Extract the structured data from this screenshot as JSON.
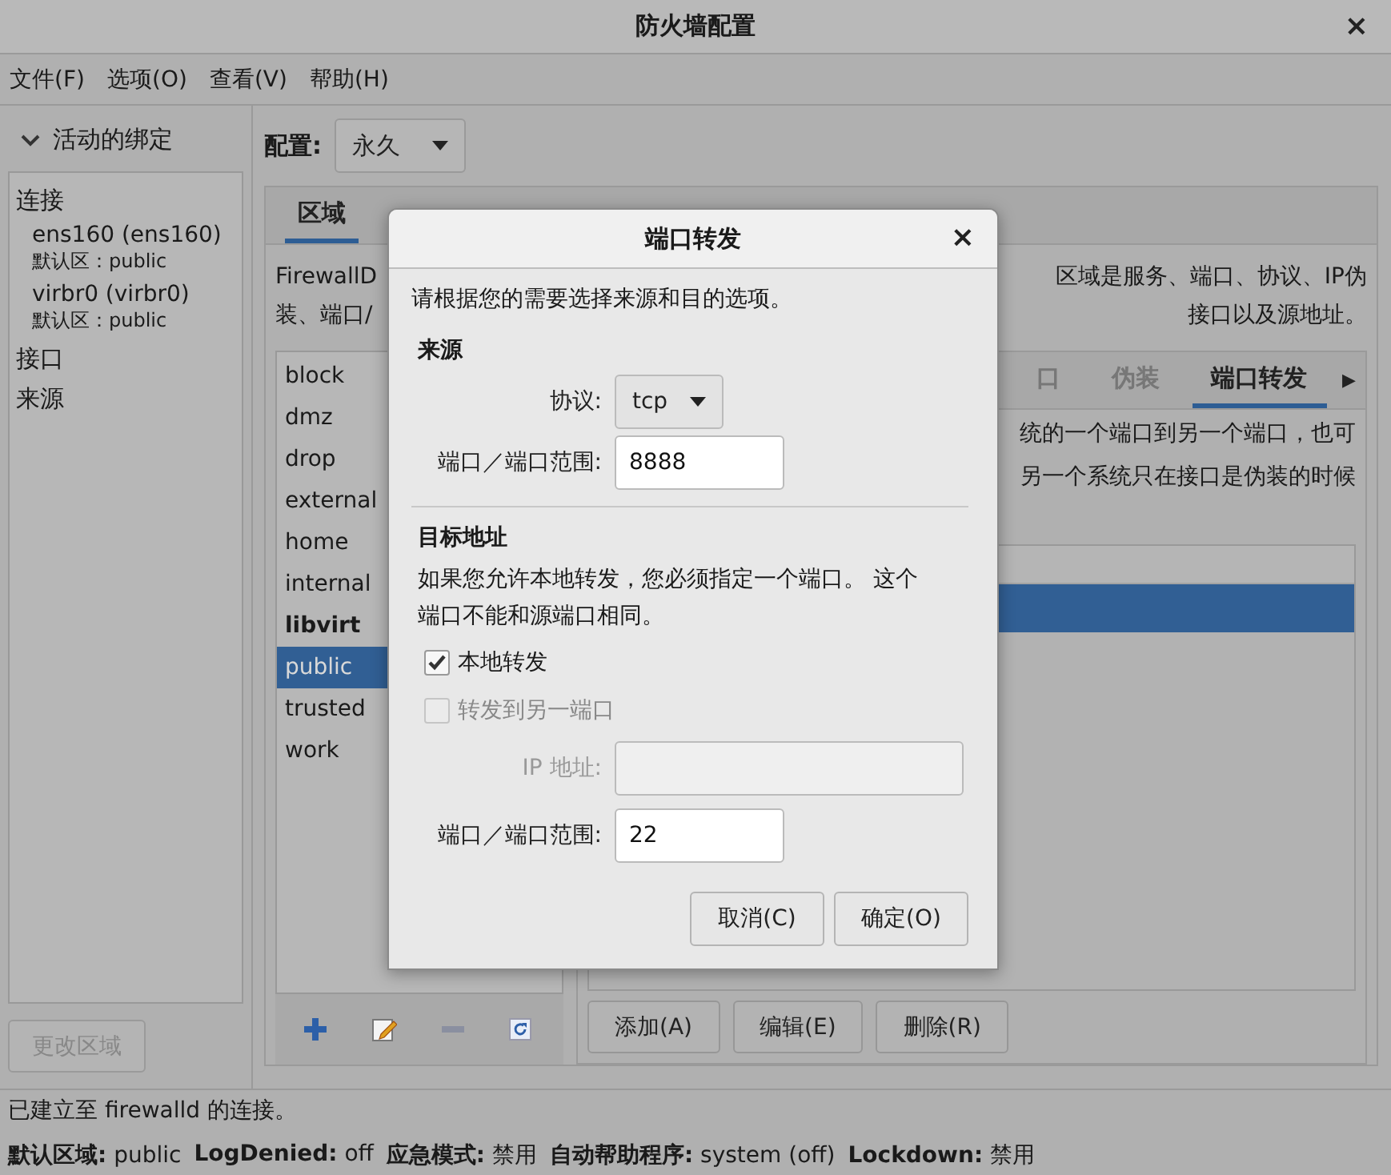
{
  "window": {
    "title": "防火墙配置",
    "close": "×"
  },
  "menu": [
    {
      "label": "文件(F)"
    },
    {
      "label": "选项(O)"
    },
    {
      "label": "查看(V)"
    },
    {
      "label": "帮助(H)"
    }
  ],
  "sidebar": {
    "header": "活动的绑定",
    "expanded": true,
    "tree": [
      {
        "label": "连接",
        "children": [
          {
            "label": "ens160 (ens160)",
            "zone": "默认区：public"
          },
          {
            "label": "virbr0 (virbr0)",
            "zone": "默认区：public"
          }
        ]
      },
      {
        "label": "接口"
      },
      {
        "label": "来源"
      }
    ],
    "button": {
      "label": "更改区域",
      "disabled": true
    }
  },
  "config": {
    "label": "配置:",
    "value": "永久"
  },
  "tabs": [
    {
      "label": "区域",
      "selected": true
    }
  ],
  "description": {
    "left": [
      "FirewallD",
      "装、端口/"
    ],
    "right": [
      "区域是服务、端口、协议、IP伪",
      "接口以及源地址。"
    ]
  },
  "zones": [
    {
      "name": "block",
      "emphasized": false,
      "selected": false
    },
    {
      "name": "dmz",
      "emphasized": false,
      "selected": false
    },
    {
      "name": "drop",
      "emphasized": false,
      "selected": false
    },
    {
      "name": "external",
      "emphasized": false,
      "selected": false
    },
    {
      "name": "home",
      "emphasized": false,
      "selected": false
    },
    {
      "name": "internal",
      "emphasized": false,
      "selected": false
    },
    {
      "name": "libvirt",
      "emphasized": true,
      "selected": false
    },
    {
      "name": "public",
      "emphasized": false,
      "selected": true
    },
    {
      "name": "trusted",
      "emphasized": false,
      "selected": false
    },
    {
      "name": "work",
      "emphasized": false,
      "selected": false
    }
  ],
  "detail": {
    "tabs": [
      {
        "label": "口",
        "selected": false
      },
      {
        "label": "伪装",
        "selected": false
      },
      {
        "label": "端口转发",
        "selected": true
      }
    ],
    "scroll_arrow": "▶",
    "text": [
      "统的一个端口到另一个端口，也可",
      "另一个系统只在接口是伪装的时候"
    ],
    "rows": [
      {
        "selected": true
      }
    ],
    "buttons": [
      {
        "label": "添加(A)"
      },
      {
        "label": "编辑(E)"
      },
      {
        "label": "删除(R)"
      }
    ]
  },
  "status": {
    "message": "已建立至 firewalld 的连接。",
    "fields": [
      {
        "label": "默认区域:",
        "value": "public"
      },
      {
        "label": "LogDenied:",
        "value": "off"
      },
      {
        "label": "应急模式:",
        "value": "禁用"
      },
      {
        "label": "自动帮助程序:",
        "value": "system (off)"
      },
      {
        "label": "Lockdown:",
        "value": "禁用"
      }
    ]
  },
  "dialog": {
    "title": "端口转发",
    "close": "×",
    "intro": "请根据您的需要选择来源和目的选项。",
    "source": {
      "heading": "来源",
      "protocol": {
        "label": "协议:",
        "value": "tcp"
      },
      "port": {
        "label": "端口／端口范围:",
        "value": "8888"
      }
    },
    "destination": {
      "heading": "目标地址",
      "note": "如果您允许本地转发，您必须指定一个端口。 这个端口不能和源端口相同。",
      "checks": [
        {
          "label": "本地转发",
          "checked": true,
          "disabled": false
        },
        {
          "label": "转发到另一端口",
          "checked": false,
          "disabled": true
        }
      ],
      "ip": {
        "label": "IP 地址:",
        "disabled": true
      },
      "port": {
        "label": "端口／端口范围:",
        "value": "22"
      }
    },
    "buttons": [
      {
        "label": "取消(C)"
      },
      {
        "label": "确定(O)"
      }
    ]
  }
}
